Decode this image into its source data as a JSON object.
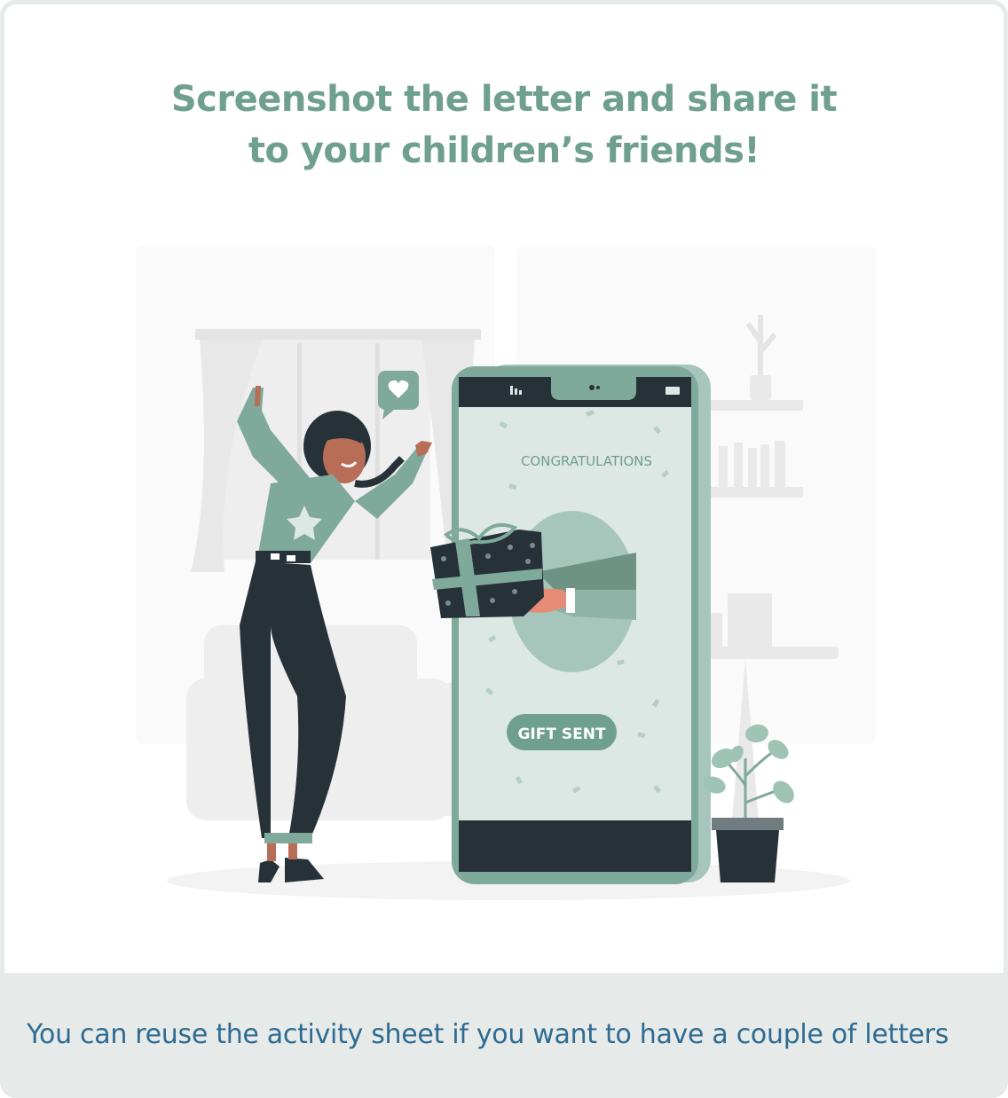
{
  "heading": {
    "line1": "Screenshot the letter and share it",
    "line2": "to your children’s friends!"
  },
  "illustration": {
    "screen_title": "CONGRATULATIONS",
    "button_label": "GIFT SENT",
    "icons": [
      "heart-icon",
      "signal-icon",
      "battery-icon",
      "star-icon"
    ]
  },
  "footer": {
    "text": "You can reuse the activity sheet if you want to have a couple of letters"
  },
  "colors": {
    "accent": "#6f9f8e",
    "dark": "#263238",
    "footer_bg": "#e6ebea",
    "footer_text": "#2f6b91"
  }
}
